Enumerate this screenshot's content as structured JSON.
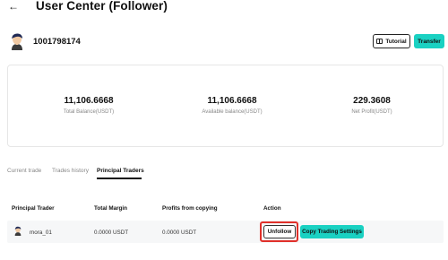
{
  "header": {
    "back_icon": "arrow-left-icon",
    "title": "User Center (Follower)"
  },
  "user": {
    "id": "1001798174",
    "avatar_icon": "user-avatar-icon"
  },
  "actions": {
    "tutorial_label": "Tutorial",
    "tutorial_icon": "book-icon",
    "transfer_label": "Transfer",
    "accent_color": "#1ad1c2"
  },
  "stats": [
    {
      "value": "11,106.6668",
      "label": "Total Balance(USDT)"
    },
    {
      "value": "11,106.6668",
      "label": "Available balance(USDT)"
    },
    {
      "value": "229.3608",
      "label": "Net Profit(USDT)"
    }
  ],
  "tabs": [
    {
      "label": "Current trade",
      "active": false
    },
    {
      "label": "Trades history",
      "active": false
    },
    {
      "label": "Principal Traders",
      "active": true
    }
  ],
  "table": {
    "headers": [
      "Principal Trader",
      "Total Margin",
      "Profits from copying",
      "Action"
    ],
    "rows": [
      {
        "trader": "mora_01",
        "total_margin": "0.0000 USDT",
        "profits": "0.0000 USDT",
        "unfollow_label": "Unfollow",
        "copy_settings_label": "Copy Trading Settings"
      }
    ]
  },
  "highlight_color": "#e0302a"
}
